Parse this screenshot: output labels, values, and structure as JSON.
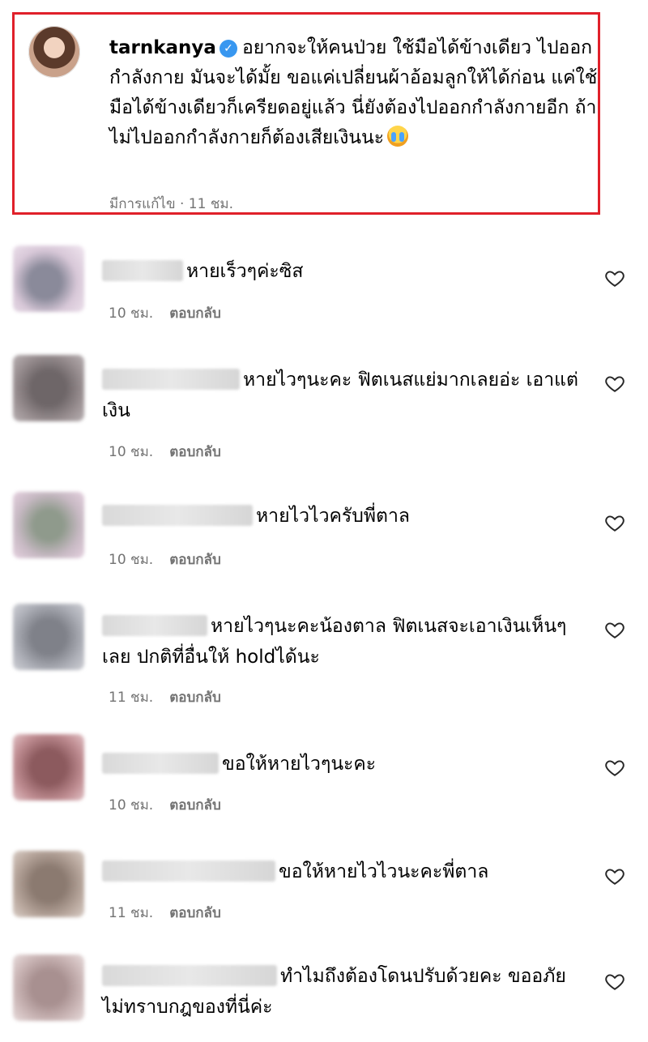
{
  "post": {
    "username": "tarnkanya",
    "text": "อยากจะให้คนป่วย ใช้มือได้ข้างเดียว ไปออกกำลังกาย มันจะได้มั้ย ขอแค่เปลี่ยนผ้าอ้อมลูกให้ได้ก่อน แค่ใช้มือได้ข้างเดียวก็เครียดอยู่แล้ว นี่ยังต้องไปออกกำลังกายอีก ถ้าไม่ไปออกกำลังกายก็ต้องเสียเงินนะ",
    "meta": "มีการแก้ไข · 11 ชม."
  },
  "comments": [
    {
      "text": "หายเร็วๆค่ะซิส",
      "time": "10 ชม.",
      "reply": "ตอบกลับ"
    },
    {
      "text": "หายไวๆนะคะ ฟิตเนสแย่มากเลยอ่ะ เอาแต่เงิน",
      "time": "10 ชม.",
      "reply": "ตอบกลับ"
    },
    {
      "text": "หายไวไวครับพี่ตาล",
      "time": "10 ชม.",
      "reply": "ตอบกลับ"
    },
    {
      "text": "หายไวๆนะคะน้องตาล ฟิตเนสจะเอาเงินเห็นๆเลย ปกติที่อื่นให้ holdได้นะ",
      "time": "11 ชม.",
      "reply": "ตอบกลับ"
    },
    {
      "text": "ขอให้หายไวๆนะคะ",
      "time": "10 ชม.",
      "reply": "ตอบกลับ"
    },
    {
      "text": "ขอให้หายไวไวนะคะพี่ตาล",
      "time": "11 ชม.",
      "reply": "ตอบกลับ"
    },
    {
      "text": "ทำไมถึงต้องโดนปรับด้วยคะ ขออภัยไม่ทราบกฎของที่นี่ค่ะ",
      "time": "",
      "reply": ""
    }
  ],
  "icons": {
    "verified": "verified-badge-icon",
    "heart": "heart-outline-icon",
    "emoji": "crying-face-emoji"
  },
  "colors": {
    "highlight_border": "#e0202a",
    "verified": "#3897f0",
    "meta_text": "#737373"
  }
}
